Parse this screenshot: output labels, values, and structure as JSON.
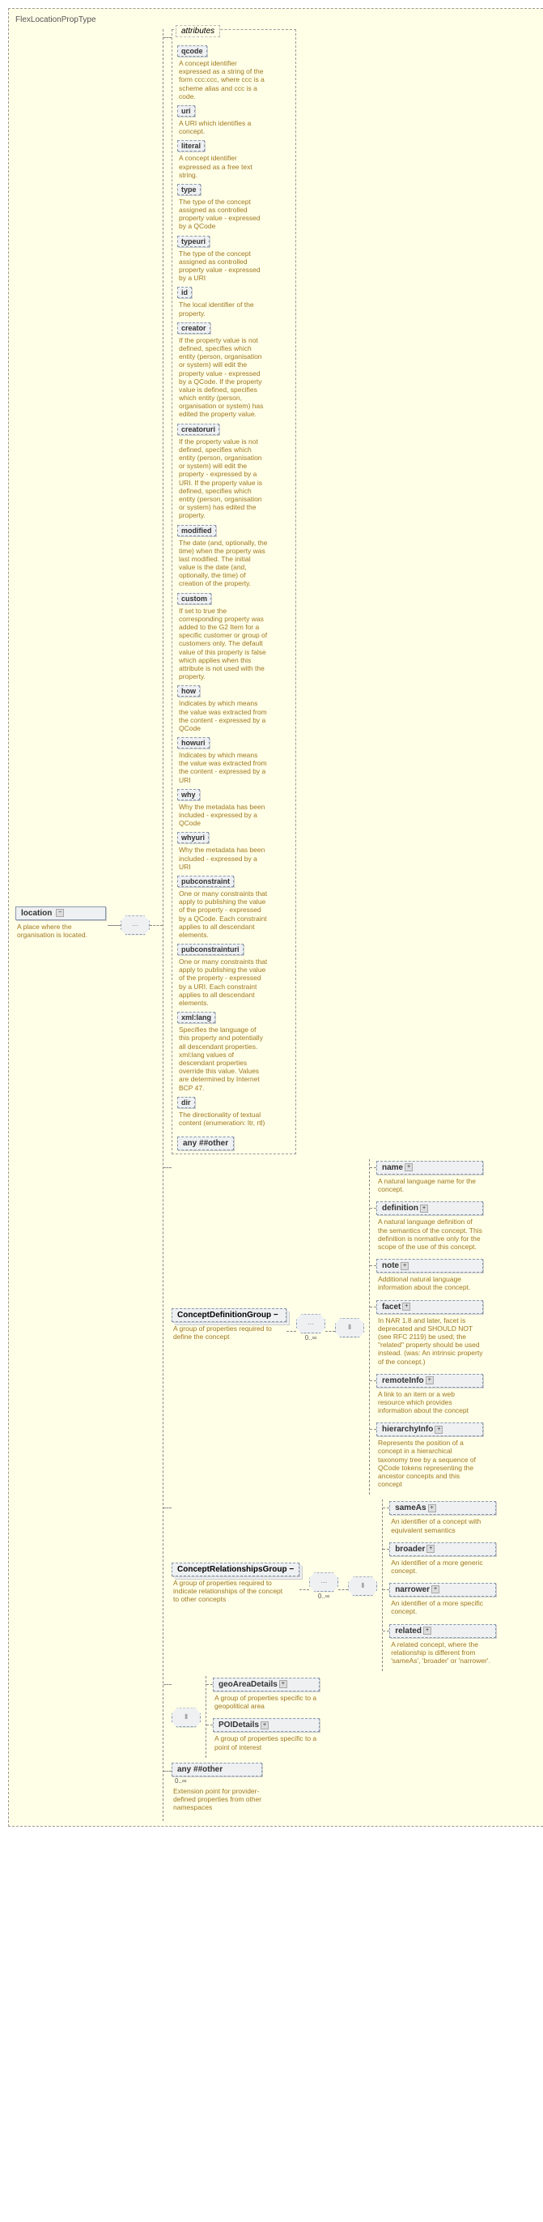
{
  "rootTypeName": "FlexLocationPropType",
  "rootElement": {
    "label": "location",
    "desc": "A place where the organisation is located."
  },
  "attributesBoxTitle": "attributes",
  "attributes": [
    {
      "name": "qcode",
      "desc": "A concept identifier expressed as a string of the form ccc:ccc, where ccc is a scheme alias and ccc is a code."
    },
    {
      "name": "uri",
      "desc": "A URI which identifies a concept."
    },
    {
      "name": "literal",
      "desc": "A concept identifier expressed as a free text string."
    },
    {
      "name": "type",
      "desc": "The type of the concept assigned as controlled property value - expressed by a QCode"
    },
    {
      "name": "typeuri",
      "desc": "The type of the concept assigned as controlled property value - expressed by a URI"
    },
    {
      "name": "id",
      "desc": "The local identifier of the property."
    },
    {
      "name": "creator",
      "desc": "If the property value is not defined, specifies which entity (person, organisation or system) will edit the property value - expressed by a QCode. If the property value is defined, specifies which entity (person, organisation or system) has edited the property value."
    },
    {
      "name": "creatoruri",
      "desc": "If the property value is not defined, specifies which entity (person, organisation or system) will edit the property - expressed by a URI. If the property value is defined, specifies which entity (person, organisation or system) has edited the property."
    },
    {
      "name": "modified",
      "desc": "The date (and, optionally, the time) when the property was last modified. The initial value is the date (and, optionally, the time) of creation of the property."
    },
    {
      "name": "custom",
      "desc": "If set to true the corresponding property was added to the G2 Item for a specific customer or group of customers only. The default value of this property is false which applies when this attribute is not used with the property."
    },
    {
      "name": "how",
      "desc": "Indicates by which means the value was extracted from the content - expressed by a QCode"
    },
    {
      "name": "howuri",
      "desc": "Indicates by which means the value was extracted from the content - expressed by a URI"
    },
    {
      "name": "why",
      "desc": "Why the metadata has been included - expressed by a QCode"
    },
    {
      "name": "whyuri",
      "desc": "Why the metadata has been included - expressed by a URI"
    },
    {
      "name": "pubconstraint",
      "desc": "One or many constraints that apply to publishing the value of the property - expressed by a QCode. Each constraint applies to all descendant elements."
    },
    {
      "name": "pubconstrainturi",
      "desc": "One or many constraints that apply to publishing the value of the property - expressed by a URI. Each constraint applies to all descendant elements."
    },
    {
      "name": "xml:lang",
      "desc": "Specifies the language of this property and potentially all descendant properties. xml:lang values of descendant properties override this value. Values are determined by Internet BCP 47."
    },
    {
      "name": "dir",
      "desc": "The directionality of textual content (enumeration: ltr, rtl)"
    }
  ],
  "anyOther1": "any ##other",
  "groups": {
    "conceptDef": {
      "label": "ConceptDefinitionGroup",
      "desc": "A group of properties required to define the concept",
      "card": "0..∞",
      "children": [
        {
          "name": "name",
          "desc": "A natural language name for the concept."
        },
        {
          "name": "definition",
          "desc": "A natural language definition of the semantics of the concept. This definition is normative only for the scope of the use of this concept."
        },
        {
          "name": "note",
          "desc": "Additional natural language information about the concept."
        },
        {
          "name": "facet",
          "desc": "In NAR 1.8 and later, facet is deprecated and SHOULD NOT (see RFC 2119) be used; the \"related\" property should be used instead. (was: An intrinsic property of the concept.)"
        },
        {
          "name": "remoteInfo",
          "desc": "A link to an item or a web resource which provides information about the concept"
        },
        {
          "name": "hierarchyInfo",
          "desc": "Represents the position of a concept in a hierarchical taxonomy tree by a sequence of QCode tokens representing the ancestor concepts and this concept"
        }
      ]
    },
    "conceptRel": {
      "label": "ConceptRelationshipsGroup",
      "desc": "A group of properties required to indicate relationships of the concept to other concepts",
      "card": "0..∞",
      "children": [
        {
          "name": "sameAs",
          "desc": "An identifier of a concept with equivalent semantics"
        },
        {
          "name": "broader",
          "desc": "An identifier of a more generic concept."
        },
        {
          "name": "narrower",
          "desc": "An identifier of a more specific concept."
        },
        {
          "name": "related",
          "desc": "A related concept, where the relationship is different from 'sameAs', 'broader' or 'narrower'."
        }
      ]
    }
  },
  "detailChoice": {
    "children": [
      {
        "name": "geoAreaDetails",
        "desc": "A group of properties specific to a geopolitical area"
      },
      {
        "name": "POIDetails",
        "desc": "A group of properties specific to a point of interest"
      }
    ]
  },
  "anyOther2": {
    "label": "any ##other",
    "desc": "Extension point for provider-defined properties from other namespaces",
    "card": "0..∞"
  }
}
